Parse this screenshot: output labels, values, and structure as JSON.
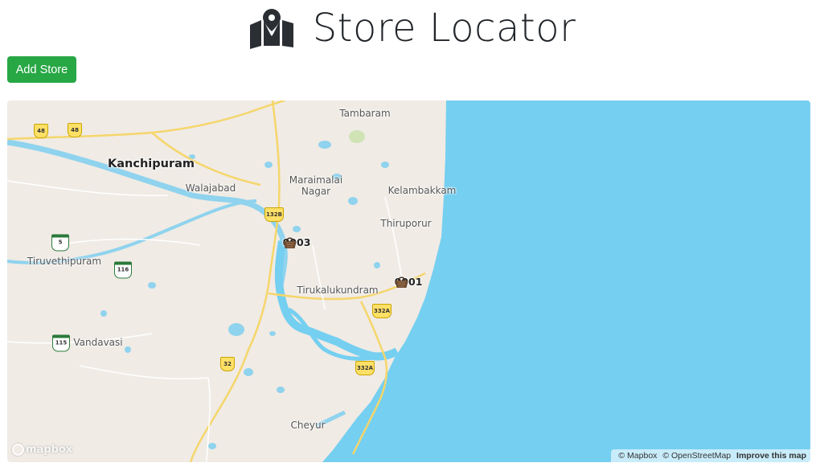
{
  "header": {
    "title": "Store Locator",
    "logo_icon": "map-marker-icon"
  },
  "toolbar": {
    "add_store_label": "Add Store"
  },
  "map": {
    "places": {
      "tambaram": "Tambaram",
      "kanchipuram": "Kanchipuram",
      "walajabad": "Walajabad",
      "maraimalai": "Maraimalai Nagar",
      "kelambakkam": "Kelambakkam",
      "thiruporur": "Thiruporur",
      "tiruvethipuram": "Tiruvethipuram",
      "tirukalukundram": "Tirukalukundram",
      "vandavasi": "Vandavasi",
      "cheyur": "Cheyur"
    },
    "shields": {
      "s48a": "48",
      "s48b": "48",
      "s132b": "132B",
      "s5": "5",
      "s116": "116",
      "s332a1": "332A",
      "s115": "115",
      "s32": "32",
      "s332a2": "332A"
    },
    "stores": [
      {
        "code": "0003",
        "icon": "basket-icon"
      },
      {
        "code": "0001",
        "icon": "basket-icon"
      }
    ],
    "logo": "mapbox",
    "attribution": {
      "mapbox": "© Mapbox",
      "osm": "© OpenStreetMap",
      "improve": "Improve this map"
    },
    "colors": {
      "water": "#75cff0",
      "land": "#f0ebe5",
      "road": "#f5d66b",
      "button": "#28a745"
    }
  }
}
